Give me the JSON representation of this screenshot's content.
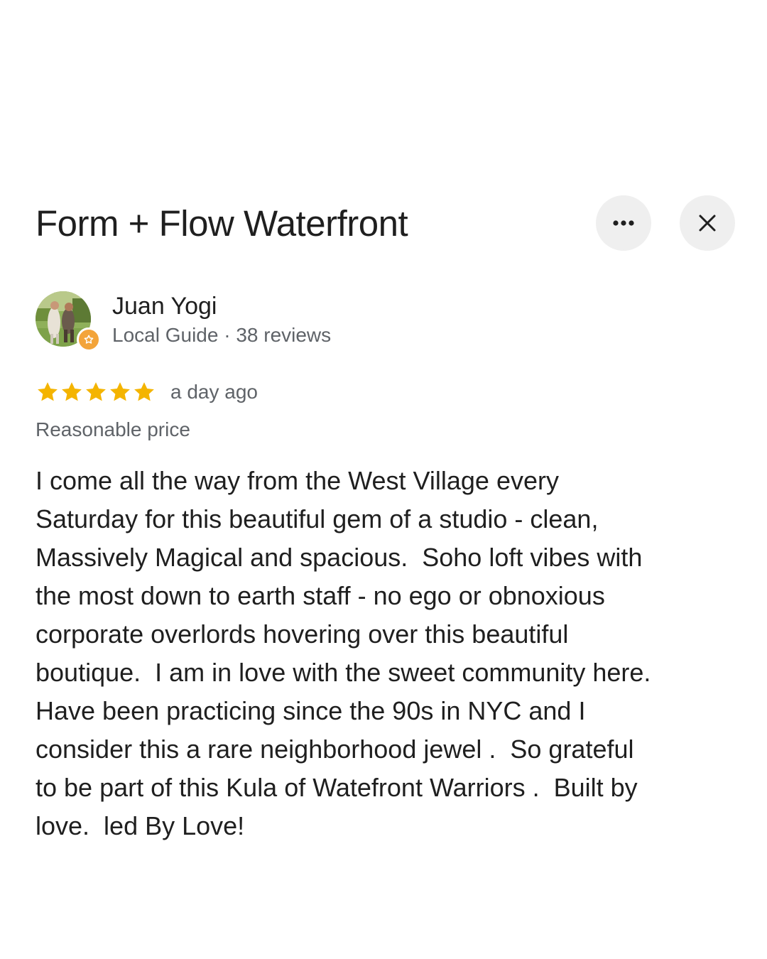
{
  "place": {
    "title": "Form + Flow Waterfront"
  },
  "header_actions": {
    "more_icon": "more-horizontal-icon",
    "close_icon": "close-icon"
  },
  "reviewer": {
    "name": "Juan Yogi",
    "meta": "Local Guide · 38 reviews",
    "badge_icon": "local-guide-star-icon"
  },
  "review": {
    "rating": 5,
    "max_rating": 5,
    "star_color": "#f4b400",
    "time": "a day ago",
    "attribute": "Reasonable price",
    "text": "I come all the way from the West Village every\nSaturday for this beautiful gem of a studio - clean,\nMassively Magical and spacious.  Soho loft vibes with\nthe most down to earth staff - no ego or obnoxious\ncorporate overlords hovering over this beautiful\nboutique.  I am in love with the sweet community here.\nHave been practicing since the 90s in NYC and I\nconsider this a rare neighborhood jewel .  So grateful\nto be part of this Kula of Watefront Warriors .  Built by\nlove.  led By Love!"
  }
}
